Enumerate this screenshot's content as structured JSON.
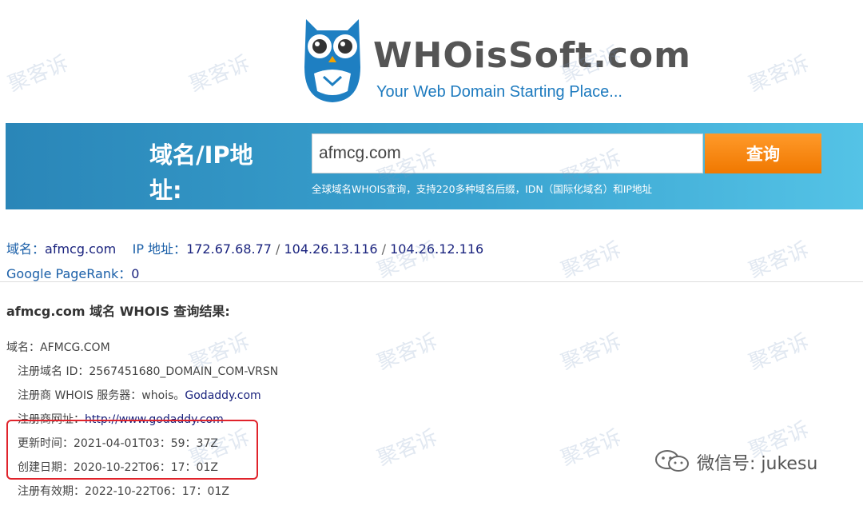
{
  "logo": {
    "name": "WHOisSoft.com",
    "tagline": "Your Web Domain Starting Place..."
  },
  "search": {
    "label": "域名/IP地址:",
    "value": "afmcg.com",
    "button": "查询",
    "hint": "全球域名WHOIS查询，支持220多种域名后缀，IDN（国际化域名）和IP地址"
  },
  "info": {
    "domain_key": "域名：",
    "domain_value": "afmcg.com",
    "ip_key": "IP 地址：",
    "ips": [
      "172.67.68.77",
      "104.26.13.116",
      "104.26.12.116"
    ],
    "ip_sep": " / ",
    "pagerank_key": "Google PageRank：",
    "pagerank_value": "0"
  },
  "result_title": "afmcg.com 域名 WHOIS 查询结果:",
  "records": [
    {
      "label": "域名：",
      "value": "AFMCG.COM",
      "indent": false,
      "link": false
    },
    {
      "label": "注册域名 ID：",
      "value": "2567451680_DOMAIN_COM-VRSN",
      "indent": true,
      "link": false
    },
    {
      "label": "注册商 WHOIS 服务器：whois。",
      "value": "Godaddy.com",
      "indent": true,
      "link": true
    },
    {
      "label": "注册商网址：",
      "value": "http://www.godaddy.com",
      "indent": true,
      "link": true
    },
    {
      "label": "更新时间：",
      "value": "2021-04-01T03：59：37Z",
      "indent": true,
      "link": false
    },
    {
      "label": "创建日期：",
      "value": "2020-10-22T06：17：01Z",
      "indent": true,
      "link": false
    },
    {
      "label": "注册有效期：",
      "value": "2022-10-22T06：17：01Z",
      "indent": true,
      "link": false
    }
  ],
  "watermark": "聚客诉",
  "wechat": "微信号: jukesu",
  "icons": {
    "owl": "owl-logo-icon",
    "wechat": "wechat-icon"
  },
  "colors": {
    "band": "#3aa3d0",
    "button": "#f07800",
    "link": "#1a237e",
    "highlight": "#e0232b"
  }
}
